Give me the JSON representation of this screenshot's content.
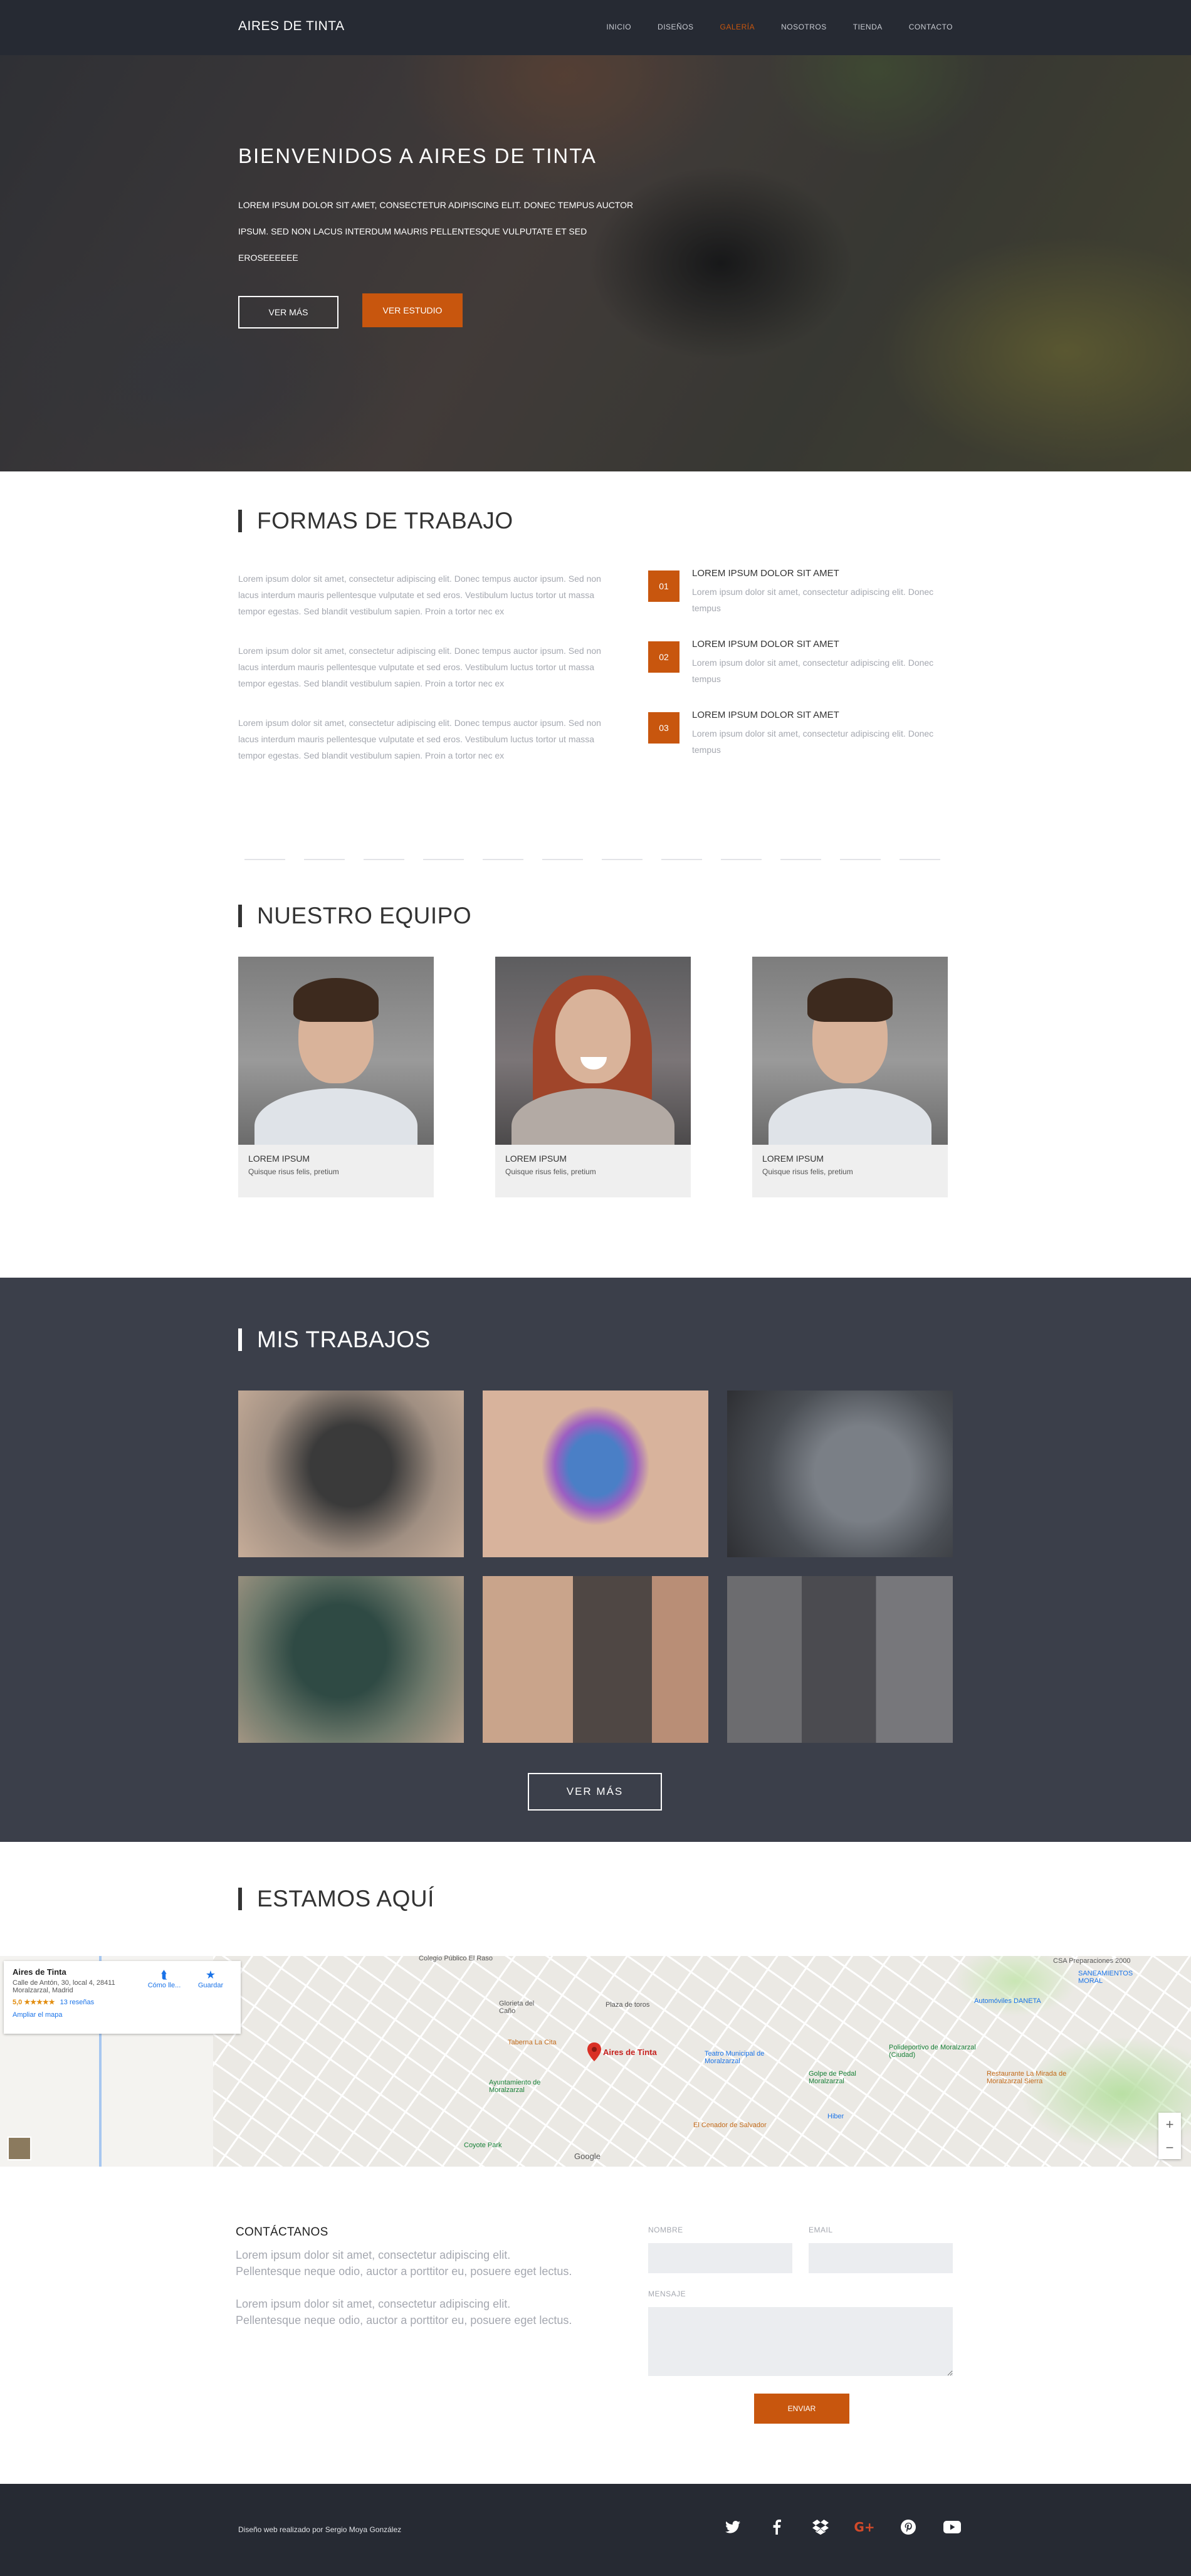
{
  "nav": {
    "brand": "AIRES DE TINTA",
    "items": [
      {
        "label": "INICIO"
      },
      {
        "label": "DISEÑOS"
      },
      {
        "label": "GALERÍA",
        "active": true
      },
      {
        "label": "NOSOTROS"
      },
      {
        "label": "TIENDA"
      },
      {
        "label": "CONTACTO"
      }
    ]
  },
  "hero": {
    "title": "BIENVENIDOS A AIRES DE TINTA",
    "text": "LOREM IPSUM DOLOR SIT AMET, CONSECTETUR ADIPISCING ELIT. DONEC TEMPUS AUCTOR IPSUM. SED NON LACUS INTERDUM MAURIS PELLENTESQUE VULPUTATE ET SED EROSEEEEEE",
    "btn_more": "VER MÁS",
    "btn_studio": "VER ESTUDIO"
  },
  "formas": {
    "title": "FORMAS DE TRABAJO",
    "paragraphs": [
      "Lorem ipsum dolor sit amet, consectetur adipiscing elit. Donec tempus auctor ipsum. Sed non lacus interdum mauris pellentesque vulputate et sed eros. Vestibulum luctus tortor ut massa tempor egestas. Sed blandit vestibulum sapien. Proin a tortor nec ex",
      "Lorem ipsum dolor sit amet, consectetur adipiscing elit. Donec tempus auctor ipsum. Sed non lacus interdum mauris pellentesque vulputate et sed eros. Vestibulum luctus tortor ut massa tempor egestas. Sed blandit vestibulum sapien. Proin a tortor nec ex",
      "Lorem ipsum dolor sit amet, consectetur adipiscing elit. Donec tempus auctor ipsum. Sed non lacus interdum mauris pellentesque vulputate et sed eros. Vestibulum luctus tortor ut massa tempor egestas. Sed blandit vestibulum sapien. Proin a tortor nec ex"
    ],
    "items": [
      {
        "num": "01",
        "title": "LOREM IPSUM DOLOR SIT AMET",
        "text": "Lorem ipsum dolor sit amet, consectetur adipiscing elit. Donec tempus"
      },
      {
        "num": "02",
        "title": "LOREM IPSUM DOLOR SIT AMET",
        "text": "Lorem ipsum dolor sit amet, consectetur adipiscing elit. Donec tempus"
      },
      {
        "num": "03",
        "title": "LOREM IPSUM DOLOR SIT AMET",
        "text": "Lorem ipsum dolor sit amet, consectetur adipiscing elit. Donec tempus"
      }
    ]
  },
  "equipo": {
    "title": "NUESTRO EQUIPO",
    "members": [
      {
        "name": "LOREM IPSUM",
        "role": "Quisque risus felis, pretium"
      },
      {
        "name": "LOREM IPSUM",
        "role": "Quisque risus felis, pretium"
      },
      {
        "name": "LOREM IPSUM",
        "role": "Quisque risus felis, pretium"
      }
    ]
  },
  "trabajos": {
    "title": "MIS TRABAJOS",
    "btn_more": "VER MÁS"
  },
  "mapa": {
    "title": "ESTAMOS AQUÍ",
    "place_name": "Aires de Tinta",
    "address": "Calle de Antón, 30, local 4, 28411 Moralzarzal, Madrid",
    "rating": "5,0 ★★★★★",
    "reviews": "13 reseñas",
    "enlarge": "Ampliar el mapa",
    "directions": "Cómo lle...",
    "save": "Guardar",
    "pin_label": "Aires de Tinta",
    "labels": {
      "colegio": "Colegio Público El Raso",
      "plaza": "Plaza de toros",
      "taberna": "Taberna La Cita",
      "glorieta": "Glorieta del Caño",
      "ayuntamiento": "Ayuntamiento de Moralzarzal",
      "teatro": "Teatro Municipal de Moralzarzal",
      "golpe": "Golpe de Pedal Moralzarzal",
      "poli": "Polideportivo de Moralzarzal (Ciudad)",
      "restaurante": "Restaurante La Mirada de Moralzarzal Sierra",
      "coyote": "Coyote Park",
      "hiber": "Hiber",
      "cenador": "El Cenador de Salvador",
      "automoviles": "Automóviles DANETA",
      "csa": "CSA Preparaciones 2000",
      "saneamientos": "SANEAMIENTOS MORAL"
    },
    "google": "Google"
  },
  "contacto": {
    "title": "CONTÁCTANOS",
    "paragraphs": [
      "Lorem ipsum dolor sit amet, consectetur adipiscing elit. Pellentesque neque odio, auctor a porttitor eu, posuere eget lectus.",
      "Lorem ipsum dolor sit amet, consectetur adipiscing elit. Pellentesque neque odio, auctor a porttitor eu, posuere eget lectus."
    ],
    "name_label": "NOMBRE",
    "email_label": "EMAIL",
    "message_label": "MENSAJE",
    "send": "ENVIAR"
  },
  "footer": {
    "credit": "Diseño web realizado por Sergio Moya González",
    "social": [
      "twitter-icon",
      "facebook-icon",
      "dropbox-icon",
      "google-plus-icon",
      "pinterest-icon",
      "youtube-icon"
    ]
  },
  "colors": {
    "accent": "#c8560e",
    "dark": "#262a33",
    "section_dark": "#3b3f4a"
  }
}
